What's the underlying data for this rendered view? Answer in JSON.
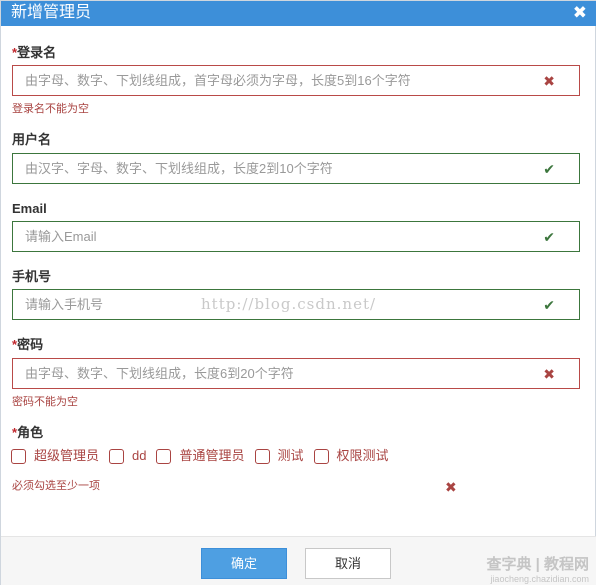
{
  "dialog": {
    "title": "新增管理员",
    "close_glyph": "✖"
  },
  "fields": {
    "login": {
      "required_mark": "*",
      "label": "登录名",
      "placeholder": "由字母、数字、下划线组成，首字母必须为字母，长度5到16个字符",
      "status": "✖",
      "status_icon": "error-x-icon",
      "error": "登录名不能为空"
    },
    "username": {
      "label": "用户名",
      "placeholder": "由汉字、字母、数字、下划线组成，长度2到10个字符",
      "status": "✔",
      "status_icon": "valid-check-icon"
    },
    "email": {
      "label": "Email",
      "placeholder": "请输入Email",
      "status": "✔",
      "status_icon": "valid-check-icon"
    },
    "phone": {
      "label": "手机号",
      "placeholder": "请输入手机号",
      "status": "✔",
      "status_icon": "valid-check-icon"
    },
    "password": {
      "required_mark": "*",
      "label": "密码",
      "placeholder": "由字母、数字、下划线组成，长度6到20个字符",
      "status": "✖",
      "status_icon": "error-x-icon",
      "error": "密码不能为空"
    }
  },
  "roles": {
    "required_mark": "*",
    "label": "角色",
    "items": [
      "超级管理员",
      "dd",
      "普通管理员",
      "测试",
      "权限测试"
    ],
    "error": "必须勾选至少一项",
    "status": "✖"
  },
  "watermark": "http://blog.csdn.net/",
  "footer": {
    "confirm_label": "确定",
    "cancel_label": "取消"
  },
  "site_mark": {
    "line1": "查字典 | 教程网",
    "line2": "jiaocheng.chazidian.com"
  },
  "colors": {
    "titlebar": "#3d8fd9",
    "error": "#a94442",
    "success": "#3c763d",
    "primary_button": "#4e9fe2"
  }
}
